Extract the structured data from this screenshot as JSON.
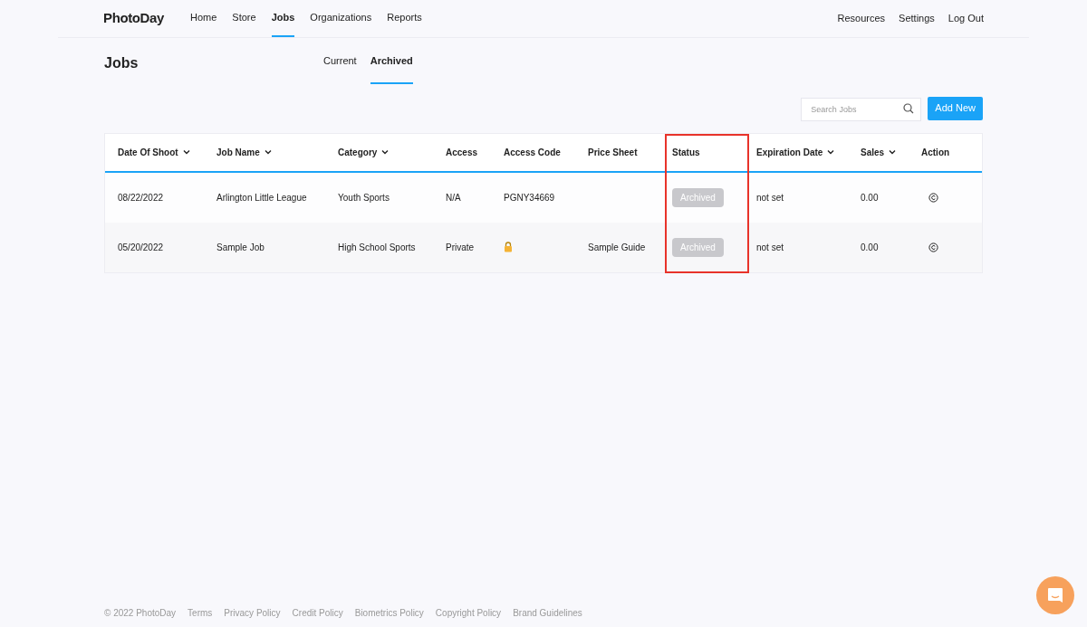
{
  "brand": "PhotoDay",
  "nav": [
    {
      "label": "Home",
      "selected": false
    },
    {
      "label": "Store",
      "selected": false
    },
    {
      "label": "Jobs",
      "selected": true
    },
    {
      "label": "Organizations",
      "selected": false
    },
    {
      "label": "Reports",
      "selected": false
    }
  ],
  "nav_right": [
    "Resources",
    "Settings",
    "Log Out"
  ],
  "page_title": "Jobs",
  "tabs": [
    {
      "label": "Current",
      "selected": false
    },
    {
      "label": "Archived",
      "selected": true
    }
  ],
  "search": {
    "placeholder": "Search Jobs"
  },
  "add_button": "Add New",
  "table": {
    "columns": [
      {
        "label": "Date Of Shoot",
        "sortable": true,
        "highlighted": false
      },
      {
        "label": "Job Name",
        "sortable": true,
        "highlighted": false
      },
      {
        "label": "Category",
        "sortable": true,
        "highlighted": false
      },
      {
        "label": "Access",
        "sortable": false,
        "highlighted": false
      },
      {
        "label": "Access Code",
        "sortable": false,
        "highlighted": false
      },
      {
        "label": "Price Sheet",
        "sortable": false,
        "highlighted": false
      },
      {
        "label": "Status",
        "sortable": false,
        "highlighted": true
      },
      {
        "label": "Expiration Date",
        "sortable": true,
        "highlighted": false
      },
      {
        "label": "Sales",
        "sortable": true,
        "highlighted": false
      },
      {
        "label": "Action",
        "sortable": false,
        "highlighted": false
      }
    ],
    "rows": [
      {
        "date": "08/22/2022",
        "job_name": "Arlington Little League",
        "category": "Youth Sports",
        "access": "N/A",
        "access_code": "PGNY34669",
        "locked": false,
        "status": "Archived",
        "expiration": "not set",
        "sales": "0.00"
      },
      {
        "date": "05/20/2022",
        "job_name": "Sample Job",
        "category": "High School Sports",
        "access": "Private",
        "locked": true,
        "price_sheet": "Sample Guide",
        "status": "Archived",
        "expiration": "not set",
        "sales": "0.00"
      }
    ]
  },
  "footer": [
    "© 2022 PhotoDay",
    "Terms",
    "Privacy Policy",
    "Credit Policy",
    "Biometrics Policy",
    "Copyright Policy",
    "Brand Guidelines"
  ]
}
